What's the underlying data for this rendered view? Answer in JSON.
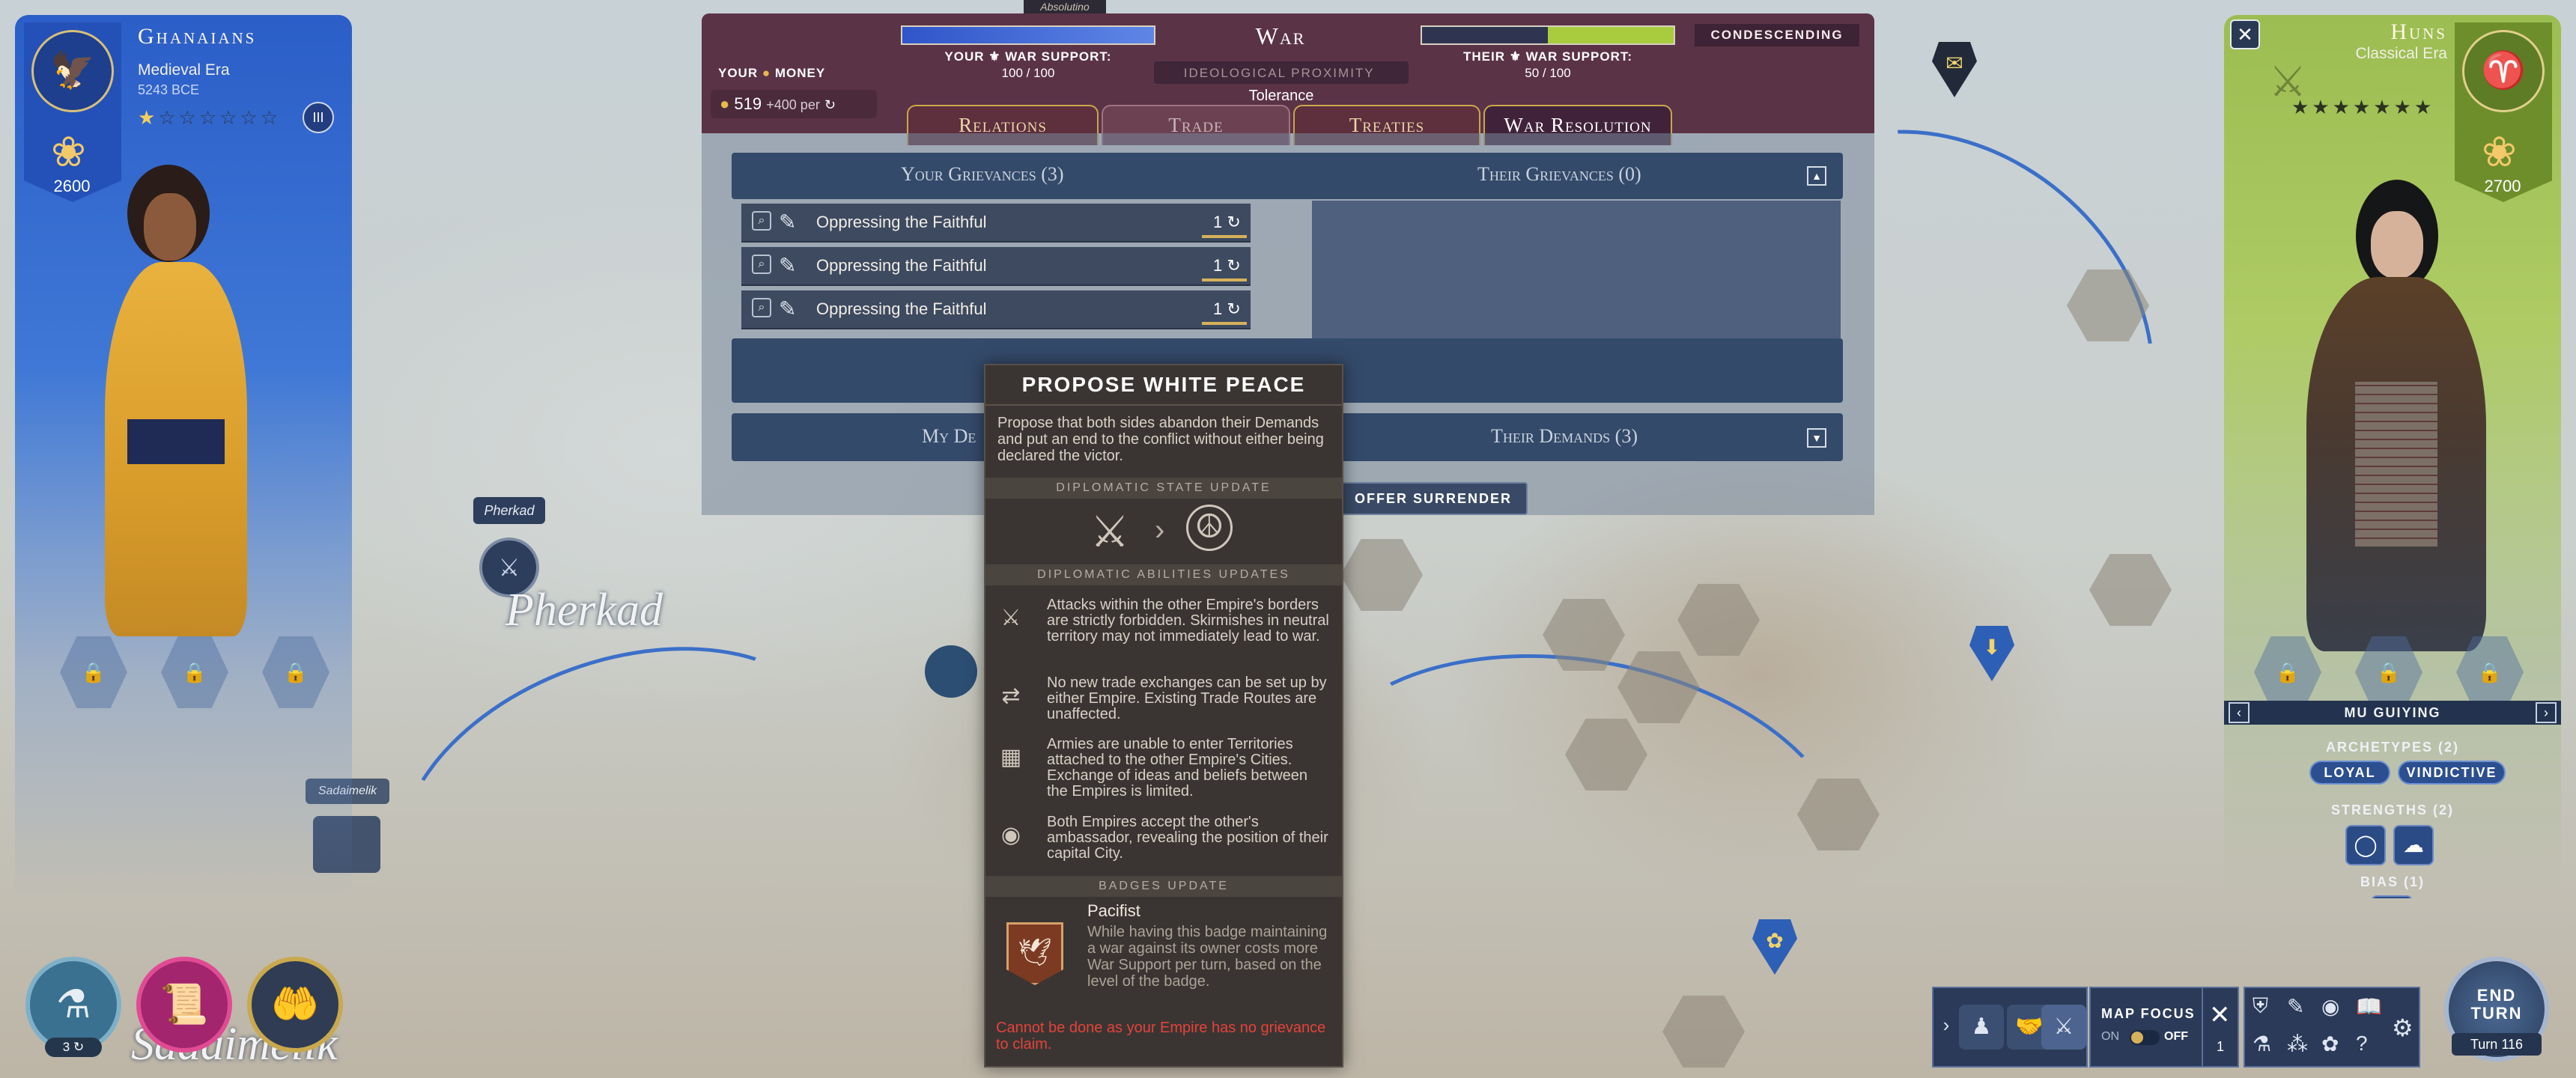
{
  "left_leader": {
    "civ_name": "Ghanaians",
    "era": "Medieval Era",
    "year": "5243 BCE",
    "score": "2600",
    "stars_filled": 1,
    "stars_total": 7,
    "era_badge": "III",
    "color": "#2f62c9"
  },
  "right_leader": {
    "civ_name": "Huns",
    "era": "Classical Era",
    "score": "2700",
    "stars_filled": 7,
    "stars_total": 7,
    "color": "#9cbd52",
    "leader_name": "MU GUIYING",
    "archetypes_label": "ARCHETYPES (2)",
    "archetypes": [
      "LOYAL",
      "VINDICTIVE"
    ],
    "strengths_label": "STRENGTHS (2)",
    "bias_label": "BIAS (1)"
  },
  "diplomacy": {
    "state": "War",
    "attitude": "CONDESCENDING",
    "your_money_label": "YOUR",
    "money_word": "MONEY",
    "money_value": "519",
    "money_rate": "+400 per",
    "your_support_label": "YOUR",
    "their_support_label": "THEIR",
    "war_support_word": "WAR SUPPORT:",
    "your_support": "100 / 100",
    "their_support": "50 / 100",
    "your_support_fraction": 1.0,
    "their_support_fraction": 0.5,
    "ideological_label": "IDEOLOGICAL PROXIMITY",
    "ideological_value": "Tolerance",
    "top_tag": "Absolutino",
    "tabs": [
      "Relations",
      "Trade",
      "Treaties",
      "War Resolution"
    ],
    "your_grievances_title": "Your Grievances (3)",
    "their_grievances_title": "Their Grievances (0)",
    "grievances": [
      {
        "name": "Oppressing the Faithful",
        "value": "1"
      },
      {
        "name": "Oppressing the Faithful",
        "value": "1"
      },
      {
        "name": "Oppressing the Faithful",
        "value": "1"
      }
    ],
    "my_demands_title": "My De",
    "their_demands_title": "Their Demands (3)",
    "offer_surrender": "OFFER SURRENDER"
  },
  "tooltip": {
    "title": "PROPOSE WHITE PEACE",
    "description": "Propose that both sides abandon their Demands and put an end to the conflict without either being declared the victor.",
    "state_update_header": "DIPLOMATIC STATE UPDATE",
    "abilities_header": "DIPLOMATIC ABILITIES UPDATES",
    "abilities": [
      {
        "icon": "crossed-swords-icon",
        "text": "Attacks within the other Empire's borders are strictly forbidden. Skirmishes in neutral territory may not immediately lead to war."
      },
      {
        "icon": "trade-route-icon",
        "text": "No new trade exchanges can be set up by either Empire. Existing Trade Routes are unaffected."
      },
      {
        "icon": "wall-icon",
        "text": "Armies are unable to enter Territories attached to the other Empire's Cities. Exchange of ideas and beliefs between the Empires is limited."
      },
      {
        "icon": "eye-icon",
        "text": "Both Empires accept the other's ambassador, revealing the position of their capital City."
      }
    ],
    "badges_header": "BADGES UPDATE",
    "badge_name": "Pacifist",
    "badge_text": "While having this badge maintaining a war against its owner costs more War Support per turn, based on the level of the badge.",
    "warning": "Cannot be done as your Empire has no grievance to claim."
  },
  "map": {
    "city_label": "Pherkad",
    "city_flag": "Pherkad",
    "city2_flag": "Sadaimelik",
    "city2_label": "Sadaimelik"
  },
  "hud": {
    "science_turns": "3",
    "map_focus_label": "MAP FOCUS",
    "on_label": "ON",
    "off_label": "OFF",
    "close_count": "1",
    "end_turn_label": "END TURN",
    "turn_label": "Turn 116"
  }
}
